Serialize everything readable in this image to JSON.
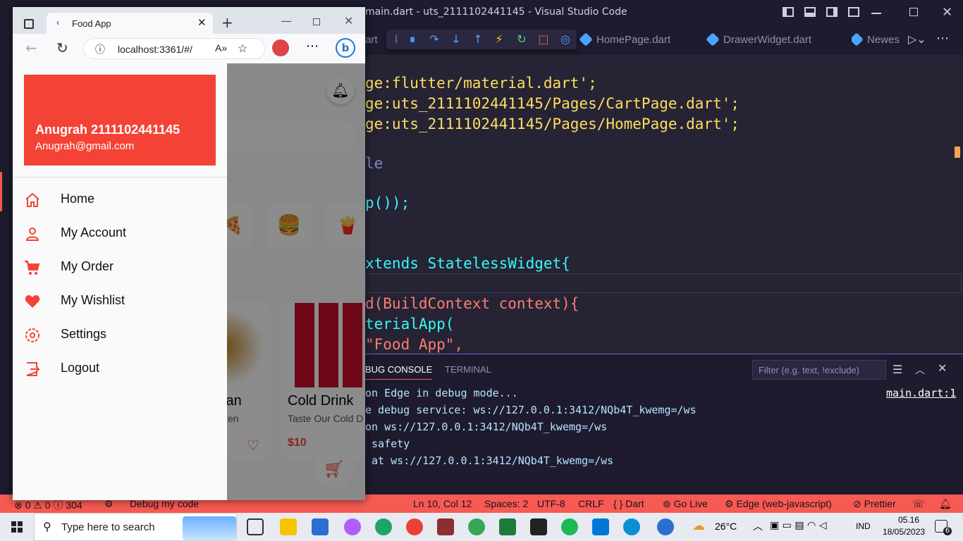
{
  "vscode": {
    "title": "main.dart - uts_2111102441145 - Visual Studio Code",
    "partial_tab": "art",
    "tabs": [
      "HomePage.dart",
      "DrawerWidget.dart",
      "Newes"
    ],
    "code": [
      [
        "ge:flutter/material.dart';"
      ],
      [
        "ge:uts_2111102441145/Pages/CartPage.dart';"
      ],
      [
        "ge:uts_2111102441145/Pages/HomePage.dart';"
      ],
      [
        "le"
      ],
      [
        "p());"
      ],
      [
        ""
      ],
      [
        "xtends StatelessWidget{"
      ],
      [
        "d(BuildContext context){"
      ],
      [
        "terialApp("
      ],
      [
        "\"Food App\","
      ]
    ],
    "panel": {
      "tab_debug": "BUG CONSOLE",
      "tab_terminal": "TERMINAL",
      "filter_placeholder": "Filter (e.g. text, !exclude)",
      "lines": [
        "on Edge in debug mode...",
        "e debug service: ws://127.0.0.1:3412/NQb4T_kwemg=/ws",
        "on ws://127.0.0.1:3412/NQb4T_kwemg=/ws",
        " safety",
        " at ws://127.0.0.1:3412/NQb4T_kwemg=/ws"
      ],
      "source_link": "main.dart:1"
    },
    "status": {
      "errors": "0",
      "warnings": "0",
      "info": "304",
      "debug": "Debug my code",
      "position": "Ln 10, Col 12",
      "spaces": "Spaces: 2",
      "encoding": "UTF-8",
      "eol": "CRLF",
      "language": "Dart",
      "golive": "Go Live",
      "device": "Edge (web-javascript)",
      "prettier": "Prettier"
    }
  },
  "browser": {
    "tab_title": "Food App",
    "url": "localhost:3361/#/"
  },
  "app": {
    "drawer": {
      "user_name": "Anugrah 2111102441145",
      "user_email": "Anugrah@gmail.com",
      "items": [
        "Home",
        "My Account",
        "My Order",
        "My Wishlist",
        "Settings",
        "Logout"
      ]
    },
    "products": [
      {
        "name": "lan",
        "desc": "ken"
      },
      {
        "name": "Cold Drink",
        "desc": "Taste Our Cold D",
        "price": "$10"
      }
    ]
  },
  "taskbar": {
    "search_placeholder": "Type here to search",
    "weather": "26°C",
    "lang": "IND",
    "time": "05.16",
    "date": "18/05/2023",
    "notif": "6"
  },
  "colors": {
    "accent": "#f44336",
    "status": "#f65a52",
    "editor_bg": "#262335"
  }
}
